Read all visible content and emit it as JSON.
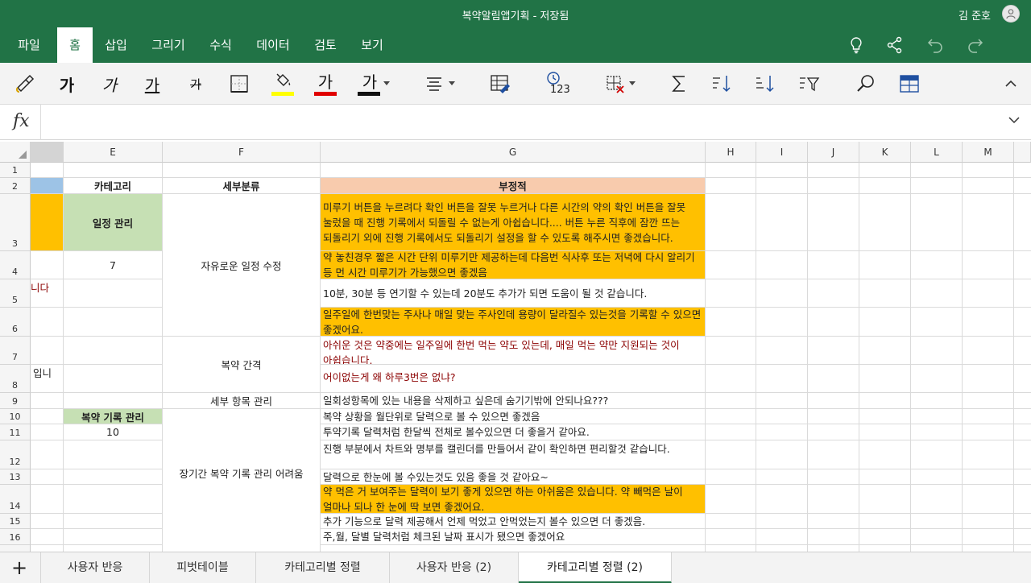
{
  "titlebar": {
    "title": "복약알림앱기획 - 저장됨",
    "user": "김 준호"
  },
  "menu": {
    "tabs": [
      "파일",
      "홈",
      "삽입",
      "그리기",
      "수식",
      "데이터",
      "검토",
      "보기"
    ],
    "active": "홈"
  },
  "ribbon": {
    "bold": "가",
    "italic": "가",
    "underline": "가",
    "strike": "가",
    "font_color_glyph": "가",
    "cell_style_glyph": "가",
    "number_format": "123",
    "highlight_color": "#ffff00",
    "font_color": "#e00000",
    "fill_color": "#111111"
  },
  "formula": {
    "fx": "fx",
    "value": ""
  },
  "columns": [
    "E",
    "F",
    "G",
    "H",
    "I",
    "J",
    "K",
    "L",
    "M"
  ],
  "rows": [
    "1",
    "2",
    "3",
    "4",
    "5",
    "6",
    "7",
    "8",
    "9",
    "10",
    "11",
    "12",
    "13",
    "14",
    "15",
    "16"
  ],
  "cells": {
    "d5": "니다",
    "d8": "입니",
    "e2": "카테고리",
    "f2": "세부분류",
    "g2": "부정적",
    "e3": "일정 관리",
    "e4": "7",
    "f_sched": "자유로운 일정 수정",
    "g3": "미루기 버튼을 누르려다 확인 버튼을 잘못 누르거나 다른 시간의 약의 확인 버튼을 잘못 눌렀을 때 진행 기록에서 되돌릴 수 없는게 아쉽습니다.... 버튼 누른 직후에 잠깐 뜨는 되돌리기 외에 진행 기록에서도 되돌리기 설정을 할 수 있도록 해주시면 좋겠습니다.",
    "g4": "약 놓친경우 짧은 시간 단위 미루기만 제공하는데 다음번 식사후 또는 저녁에 다시 알리기 등 먼 시간 미루기가 가능했으면 좋겠음",
    "g5": "10분, 30분 등 연기할 수 있는데 20분도 추가가 되면 도움이 될 것 같습니다.",
    "g6": "일주일에 한번맞는 주사나 매일 맞는 주사인데 용량이 달라질수 있는것을 기록할 수 있으면 좋겠어요.",
    "f_interval": "복약 간격",
    "g7": "아쉬운 것은 약중에는 일주일에 한번 먹는 약도 있는데, 매일 먹는 약만 지원되는 것이 아쉽습니다.",
    "g8": "어이없는게 왜 하루3번은 없냐?",
    "f9": "세부 항목 관리",
    "g9": "일회성항목에 있는 내용을 삭제하고 싶은데 숨기기밖에 안되나요???",
    "e10": "복약 기록 관리",
    "e11": "10",
    "f_long": "장기간 복약 기록 관리 어려움",
    "g10": "복약 상황을 월단위로 달력으로 볼 수 있으면 좋겠음",
    "g11": "투약기록 달력처럼 한달씩 전체로 볼수있으면 더 좋을거 같아요.",
    "g12": "진행 부분에서 차트와 명부를 캘린더를 만들어서 같이 확인하면 편리할것 같습니다.",
    "g13": "달력으로 한눈에 볼 수있는것도 있음 좋을 것 같아요~",
    "g14": "약 먹은 거 보여주는 달력이 보기 좋게 있으면 하는 아쉬움은 있습니다. 약 빼먹은 날이 얼마나 되나 한 눈에 딱 보면 좋겠어요.",
    "g15": "추가 기능으로 달력 제공해서 언제 먹었고 안먹었는지 볼수 있으면 더 좋겠음.",
    "g16": "주,월, 달별 달력처럼 체크된 날짜 표시가 됐으면 좋겠어요"
  },
  "sheets": [
    "사용자 반응",
    "피벗테이블",
    "카테고리별 정렬",
    "사용자 반응 (2)",
    "카테고리별 정렬 (2)"
  ],
  "active_sheet": "카테고리별 정렬 (2)",
  "colors": {
    "brand": "#217346",
    "orange": "#ffc000",
    "green": "#c6e0b4",
    "blue": "#9dc3e6",
    "salmon": "#f8cbad"
  }
}
